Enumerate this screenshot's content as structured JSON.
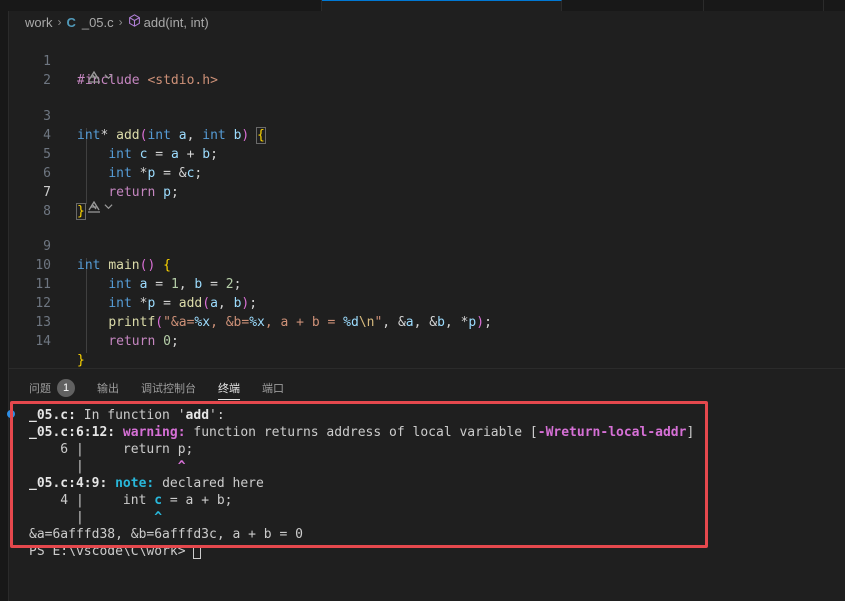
{
  "breadcrumb": {
    "folder": "work",
    "file_icon": "C",
    "file": "_05.c",
    "symbol": "add(int, int)"
  },
  "editor": {
    "codelens_icon": "copilot-icon",
    "active_line": 7,
    "lines": [
      {
        "no": "1",
        "text": "#include <stdio.h>"
      },
      {
        "no": "2",
        "text": ""
      },
      {
        "no": "3",
        "text": "int* add(int a, int b) {"
      },
      {
        "no": "4",
        "text": "    int c = a + b;"
      },
      {
        "no": "5",
        "text": "    int *p = &c;"
      },
      {
        "no": "6",
        "text": "    return p;"
      },
      {
        "no": "7",
        "text": "}"
      },
      {
        "no": "8",
        "text": ""
      },
      {
        "no": "9",
        "text": "int main() {"
      },
      {
        "no": "10",
        "text": "    int a = 1, b = 2;"
      },
      {
        "no": "11",
        "text": "    int *p = add(a, b);"
      },
      {
        "no": "12",
        "text": "    printf(\"&a=%x, &b=%x, a + b = %d\\n\", &a, &b, *p);"
      },
      {
        "no": "13",
        "text": "    return 0;"
      },
      {
        "no": "14",
        "text": "}"
      }
    ]
  },
  "panel": {
    "tabs": [
      {
        "label": "问题",
        "badge": "1"
      },
      {
        "label": "输出"
      },
      {
        "label": "调试控制台"
      },
      {
        "label": "终端",
        "active": true
      },
      {
        "label": "端口"
      }
    ]
  },
  "terminal": {
    "l1_file": "_05.c:",
    "l1_text": " In function '",
    "l1_func": "add",
    "l1_end": "':",
    "l2_loc": "_05.c:6:12:",
    "l2_kind": "warning:",
    "l2_text": " function returns address of local variable [",
    "l2_flag": "-Wreturn-local-addr",
    "l2_end": "]",
    "l3_text": "    6 |     return p;",
    "l4_bar": "      |",
    "l4_caret": "            ^",
    "l5_loc": "_05.c:4:9:",
    "l5_kind": "note:",
    "l5_text": " declared here",
    "l6_pre": "    4 |     int ",
    "l6_var": "c",
    "l6_post": " = a + b;",
    "l7_bar": "      |",
    "l7_caret": "         ^",
    "l8_text": "&a=6afffd38, &b=6afffd3c, a + b = 0",
    "prompt": "PS E:\\vscode\\C\\work> "
  }
}
